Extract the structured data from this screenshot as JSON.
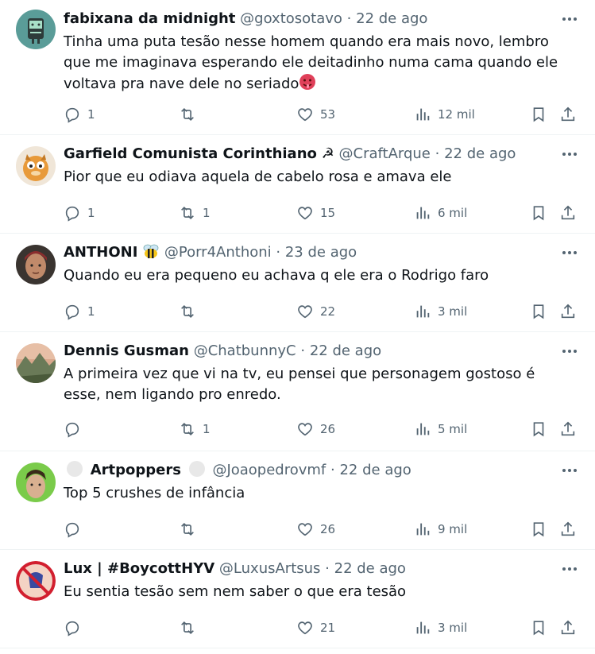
{
  "tweets": [
    {
      "name": "fabixana da midnight",
      "handle": "@goxtosotavo",
      "time": "22 de ago",
      "text": "Tinha uma puta tesão nesse homem quando era mais novo, lembro que me imaginava esperando ele deitadinho numa cama quando ele voltava pra nave dele no seriado",
      "replies": "1",
      "retweets": "",
      "likes": "53",
      "views": "12 mil"
    },
    {
      "name": "Garfield Comunista Corinthiano",
      "name_emoji": "☭",
      "handle": "@CraftArque",
      "time": "22 de ago",
      "text": "Pior que eu odiava aquela de cabelo rosa e amava ele",
      "replies": "1",
      "retweets": "1",
      "likes": "15",
      "views": "6 mil"
    },
    {
      "name": "ANTHONI",
      "name_emoji": "bee",
      "handle": "@Porr4Anthoni",
      "time": "23 de ago",
      "text": "Quando eu era pequeno eu achava q ele era o Rodrigo faro",
      "replies": "1",
      "retweets": "",
      "likes": "22",
      "views": "3 mil"
    },
    {
      "name": "Dennis Gusman",
      "handle": "@ChatbunnyC",
      "time": "22 de ago",
      "text": "A primeira vez que vi na tv, eu pensei que personagem gostoso é esse, nem ligando pro enredo.",
      "replies": "",
      "retweets": "1",
      "likes": "26",
      "views": "5 mil"
    },
    {
      "name": "Artpoppers",
      "handle": "@Joaopedrovmf",
      "time": "22 de ago",
      "text": "Top 5 crushes de infância",
      "replies": "",
      "retweets": "",
      "likes": "26",
      "views": "9 mil"
    },
    {
      "name": "Lux | #BoycottHYV",
      "handle": "@LuxusArtsus",
      "time": "22 de ago",
      "text": "Eu sentia tesão sem nem saber o que era tesão",
      "replies": "",
      "retweets": "",
      "likes": "21",
      "views": "3 mil"
    }
  ],
  "separator": "·",
  "icons": {
    "reply": "reply-icon",
    "retweet": "retweet-icon",
    "like": "heart-icon",
    "views": "views-icon",
    "bookmark": "bookmark-icon",
    "share": "share-icon",
    "more": "more-icon"
  },
  "colors": {
    "text": "#0f1419",
    "secondary": "#536471",
    "border": "#eff3f4"
  }
}
